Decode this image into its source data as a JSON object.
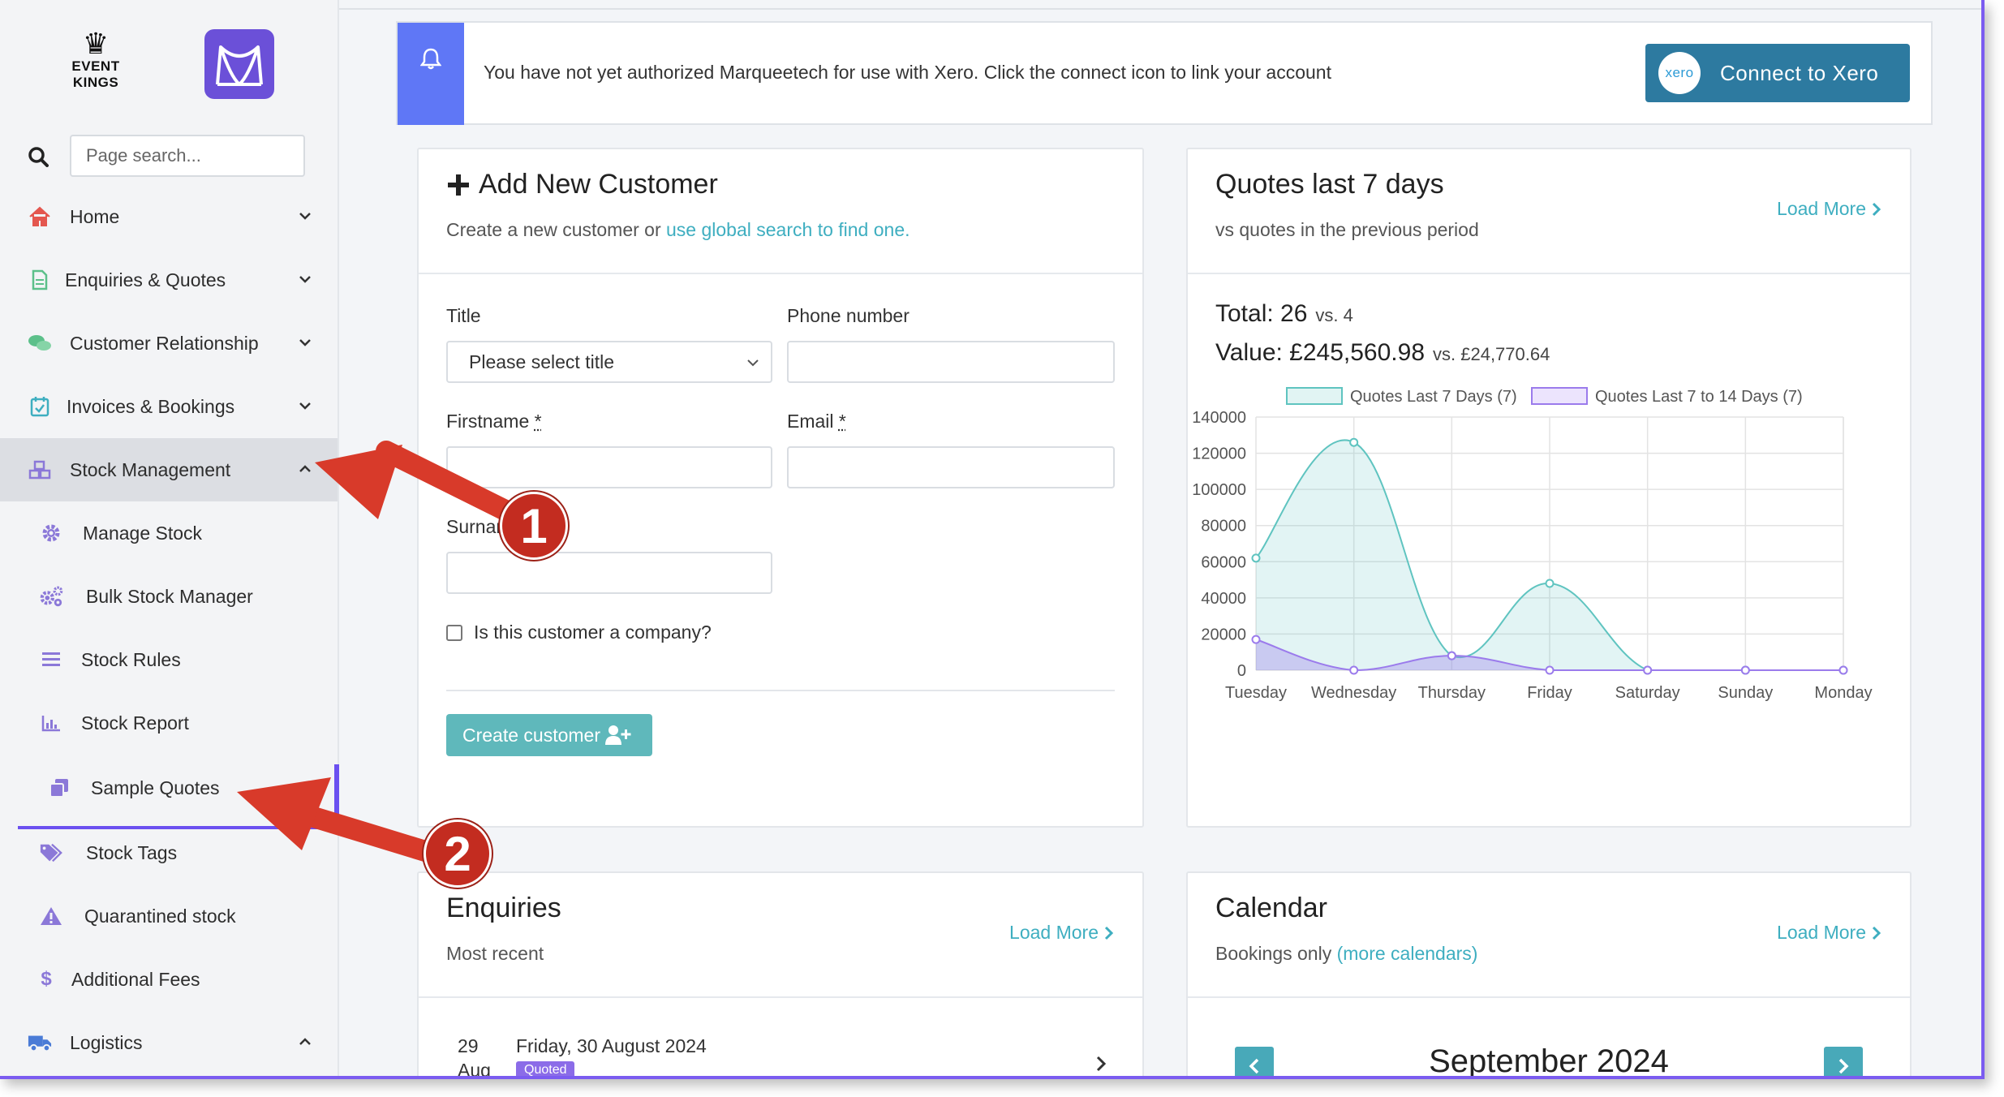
{
  "sidebar": {
    "brand_logo": {
      "icon": "crown-icon",
      "line1": "EVENT",
      "line2": "KINGS"
    },
    "app_logo_icon": "marquee-tent-icon",
    "search": {
      "placeholder": "Page search..."
    },
    "items": [
      {
        "label": "Home",
        "icon": "home-icon",
        "color": "#e4574f"
      },
      {
        "label": "Enquiries & Quotes",
        "icon": "document-icon",
        "color": "#5cc08a"
      },
      {
        "label": "Customer Relationship",
        "icon": "chat-icon",
        "color": "#5cc08a"
      },
      {
        "label": "Invoices & Bookings",
        "icon": "calendar-check-icon",
        "color": "#3eaec0"
      },
      {
        "label": "Stock Management",
        "icon": "boxes-icon",
        "color": "#8b78d8"
      },
      {
        "label": "Manage Stock",
        "icon": "gear-icon",
        "color": "#8b78d8"
      },
      {
        "label": "Bulk Stock Manager",
        "icon": "gears-icon",
        "color": "#8b78d8"
      },
      {
        "label": "Stock Rules",
        "icon": "list-icon",
        "color": "#8b78d8"
      },
      {
        "label": "Stock Report",
        "icon": "bar-chart-icon",
        "color": "#8b78d8"
      },
      {
        "label": "Sample Quotes",
        "icon": "copy-icon",
        "color": "#8b78d8"
      },
      {
        "label": "Stock Tags",
        "icon": "tags-icon",
        "color": "#8b78d8"
      },
      {
        "label": "Quarantined stock",
        "icon": "warning-icon",
        "color": "#8b78d8"
      },
      {
        "label": "Additional Fees",
        "icon": "dollar-icon",
        "color": "#8b78d8"
      },
      {
        "label": "Logistics",
        "icon": "truck-icon",
        "color": "#4a7bd6"
      }
    ]
  },
  "alert": {
    "icon": "bell-icon",
    "message": "You have not yet authorized Marqueetech for use with Xero. Click the connect icon to link your account",
    "button_label": "Connect to Xero",
    "button_logo": "xero"
  },
  "add_customer": {
    "title": "Add New Customer",
    "subtitle_prefix": "Create a new customer or ",
    "subtitle_link": "use global search to find one.",
    "title_label": "Title",
    "title_select_value": "Please select title",
    "phone_label": "Phone number",
    "firstname_label": "Firstname",
    "email_label": "Email",
    "surname_label": "Surname",
    "required_mark": "*",
    "company_checkbox_label": "Is this customer a company?",
    "create_button": "Create customer"
  },
  "quotes_card": {
    "title": "Quotes last 7 days",
    "subtitle": "vs quotes in the previous period",
    "load_more": "Load More",
    "total_label": "Total: 26",
    "total_vs": "vs. 4",
    "value_label": "Value: £245,560.98",
    "value_vs": "vs. £24,770.64"
  },
  "chart_data": {
    "type": "area",
    "categories": [
      "Tuesday",
      "Wednesday",
      "Thursday",
      "Friday",
      "Saturday",
      "Sunday",
      "Monday"
    ],
    "series": [
      {
        "name": "Quotes Last 7 Days (7)",
        "values": [
          62000,
          126000,
          8000,
          48000,
          0,
          0,
          0
        ],
        "color": "#5fc4c0"
      },
      {
        "name": "Quotes Last 7 to 14 Days (7)",
        "values": [
          17000,
          0,
          8000,
          0,
          0,
          0,
          0
        ],
        "color": "#9b7bec"
      }
    ],
    "y_ticks": [
      "140000",
      "120000",
      "100000",
      "80000",
      "60000",
      "40000",
      "20000",
      "0"
    ],
    "ylim": [
      0,
      140000
    ],
    "legend": "top",
    "grid": true
  },
  "enquiries_card": {
    "title": "Enquiries",
    "subtitle": "Most recent",
    "load_more": "Load More",
    "first_item": {
      "day": "29",
      "month": "Aug",
      "date": "Friday, 30 August 2024",
      "badge": "Quoted"
    }
  },
  "calendar_card": {
    "title": "Calendar",
    "subtitle_prefix": "Bookings only ",
    "subtitle_link": "(more calendars)",
    "load_more": "Load More",
    "month": "September 2024"
  },
  "annotations": {
    "badge1": "1",
    "badge2": "2",
    "arrow_color": "#d83a2a"
  }
}
